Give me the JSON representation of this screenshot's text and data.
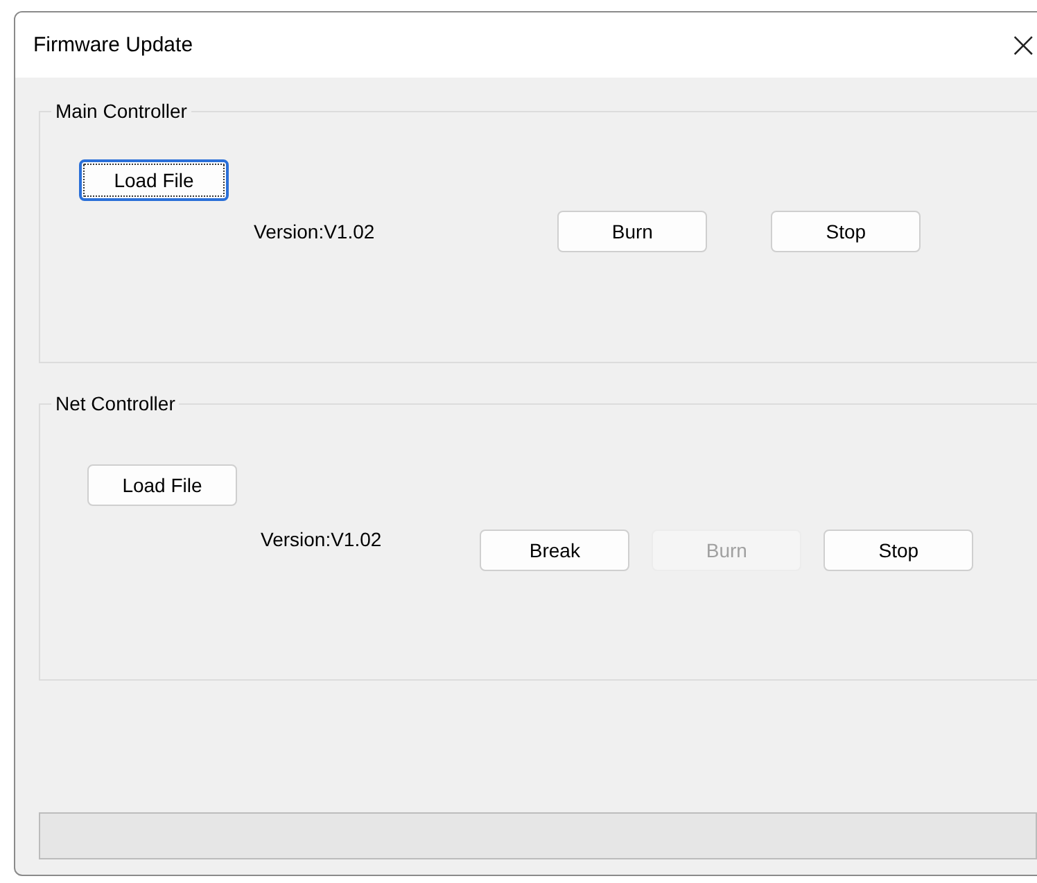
{
  "window": {
    "title": "Firmware Update",
    "close": "×"
  },
  "groups": [
    {
      "title": "Main Controller",
      "load_button": {
        "label": "Load File",
        "focused": true
      },
      "version": "Version:V1.02",
      "buttons": [
        {
          "label": "Burn",
          "disabled": false
        },
        {
          "label": "Stop",
          "disabled": false
        }
      ]
    },
    {
      "title": "Net Controller",
      "load_button": {
        "label": "Load File",
        "focused": false
      },
      "version": "Version:V1.02",
      "buttons": [
        {
          "label": "Break",
          "disabled": false
        },
        {
          "label": "Burn",
          "disabled": true
        },
        {
          "label": "Stop",
          "disabled": false
        }
      ]
    }
  ],
  "progress": {
    "level": 0
  }
}
